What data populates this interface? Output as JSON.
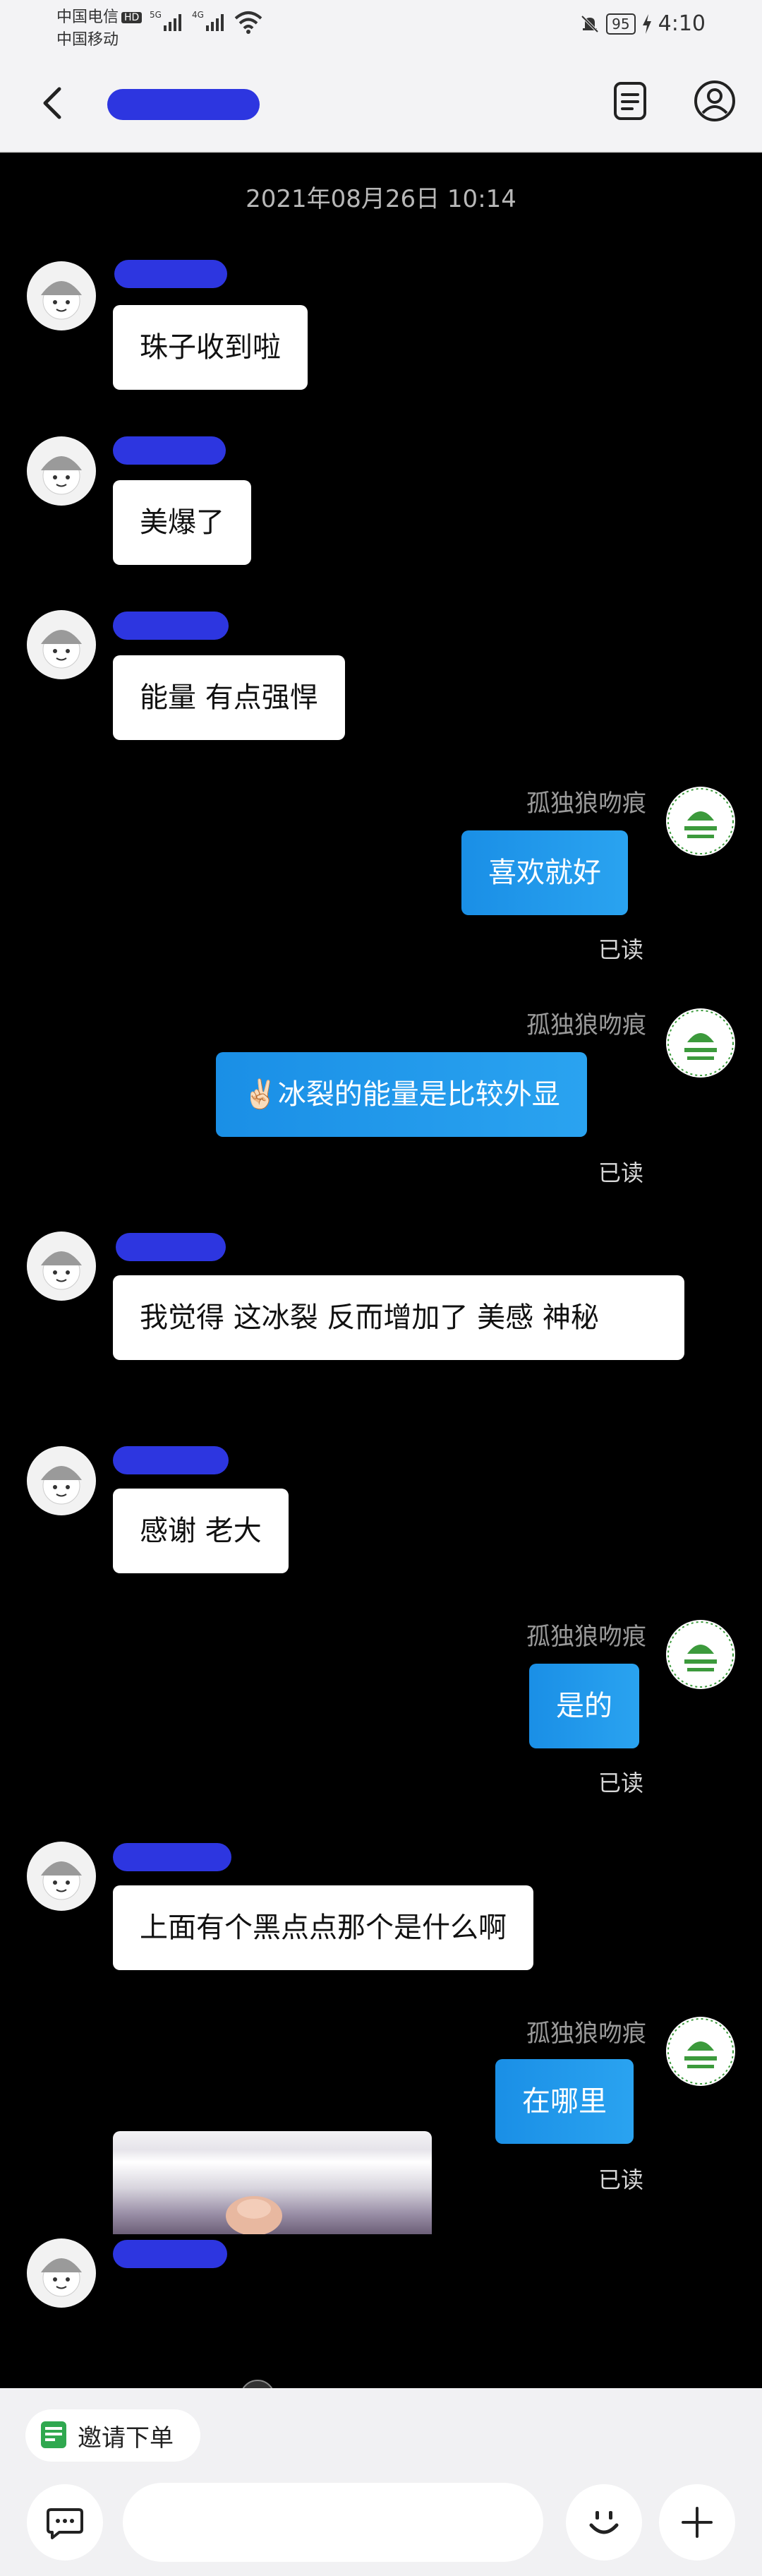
{
  "status_bar": {
    "carrier_primary": "中国电信",
    "hd_badge": "HD",
    "carrier_secondary": "中国移动",
    "sig1": "5G",
    "sig2": "4G",
    "battery": "95",
    "time": "4:10"
  },
  "header": {
    "title": "redacted"
  },
  "chat": {
    "timestamp": "2021年08月26日 10:14",
    "shop_name": "孤独狼吻痕",
    "read_label": "已读",
    "messages": [
      {
        "side": "in",
        "text": "珠子收到啦"
      },
      {
        "side": "in",
        "text": "美爆了"
      },
      {
        "side": "in",
        "text": "能量 有点强悍"
      },
      {
        "side": "out",
        "text": "喜欢就好"
      },
      {
        "side": "out",
        "text": "✌🏻冰裂的能量是比较外显"
      },
      {
        "side": "in",
        "text": "我觉得 这冰裂 反而增加了 美感 神秘"
      },
      {
        "side": "in",
        "text": "感谢 老大"
      },
      {
        "side": "out",
        "text": "是的"
      },
      {
        "side": "in",
        "text": "上面有个黑点点那个是什么啊"
      },
      {
        "side": "out",
        "text": "在哪里"
      },
      {
        "side": "in",
        "type": "image"
      }
    ]
  },
  "bottom_bar": {
    "invite_order_label": "邀请下单",
    "input_placeholder": ""
  },
  "colors": {
    "outgoing_bubble": "#1a8fe6",
    "incoming_bubble": "#ffffff",
    "chat_background": "#000000",
    "redaction": "#2d36e0"
  }
}
